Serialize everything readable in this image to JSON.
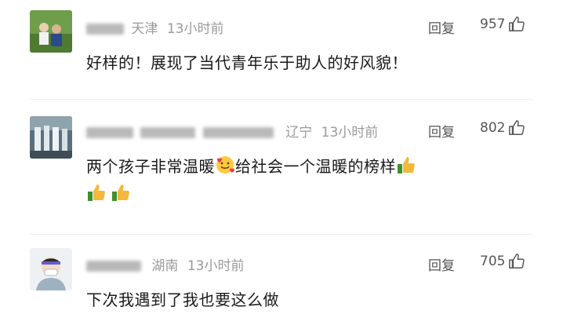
{
  "comments": [
    {
      "location": "天津",
      "time": "13小时前",
      "reply_label": "回复",
      "likes": "957",
      "text": "好样的！展现了当代青年乐于助人的好风貌！"
    },
    {
      "location": "辽宁",
      "time": "13小时前",
      "reply_label": "回复",
      "likes": "802",
      "text_part1": "两个孩子非常温暖",
      "text_part2": "给社会一个温暖的榜样"
    },
    {
      "location": "湖南",
      "time": "13小时前",
      "reply_label": "回复",
      "likes": "705",
      "text": "下次我遇到了我也要这么做"
    }
  ],
  "icons": {
    "like": "thumb-up-icon",
    "emoji_smile": "smiling-face-with-hearts-icon",
    "emoji_thumb": "thumbs-up-emoji-icon"
  }
}
